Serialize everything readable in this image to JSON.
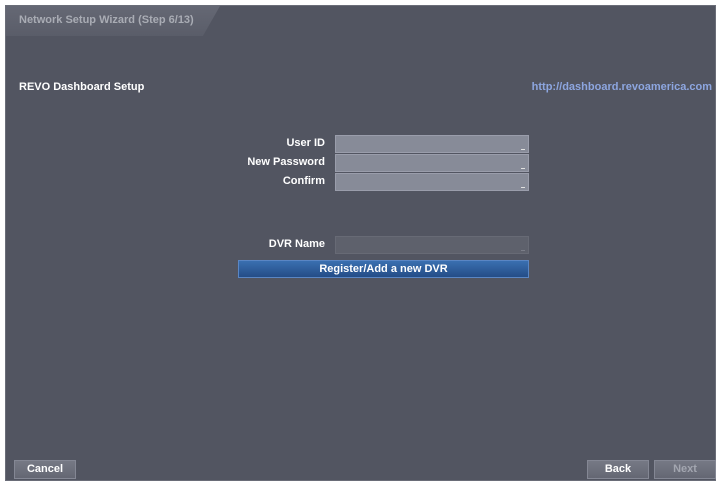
{
  "window": {
    "title": "Network Setup Wizard (Step 6/13)"
  },
  "section": {
    "title": "REVO Dashboard Setup",
    "url": "http://dashboard.revoamerica.com"
  },
  "form": {
    "user_id": {
      "label": "User ID",
      "value": ""
    },
    "new_password": {
      "label": "New Password",
      "value": ""
    },
    "confirm": {
      "label": "Confirm",
      "value": ""
    },
    "dvr_name": {
      "label": "DVR Name",
      "value": ""
    }
  },
  "register_button": "Register/Add a new DVR",
  "footer": {
    "cancel": "Cancel",
    "back": "Back",
    "next": "Next"
  },
  "colors": {
    "background": "#525561",
    "accent_button": "#2f5e9d",
    "link": "#8da6e0"
  }
}
